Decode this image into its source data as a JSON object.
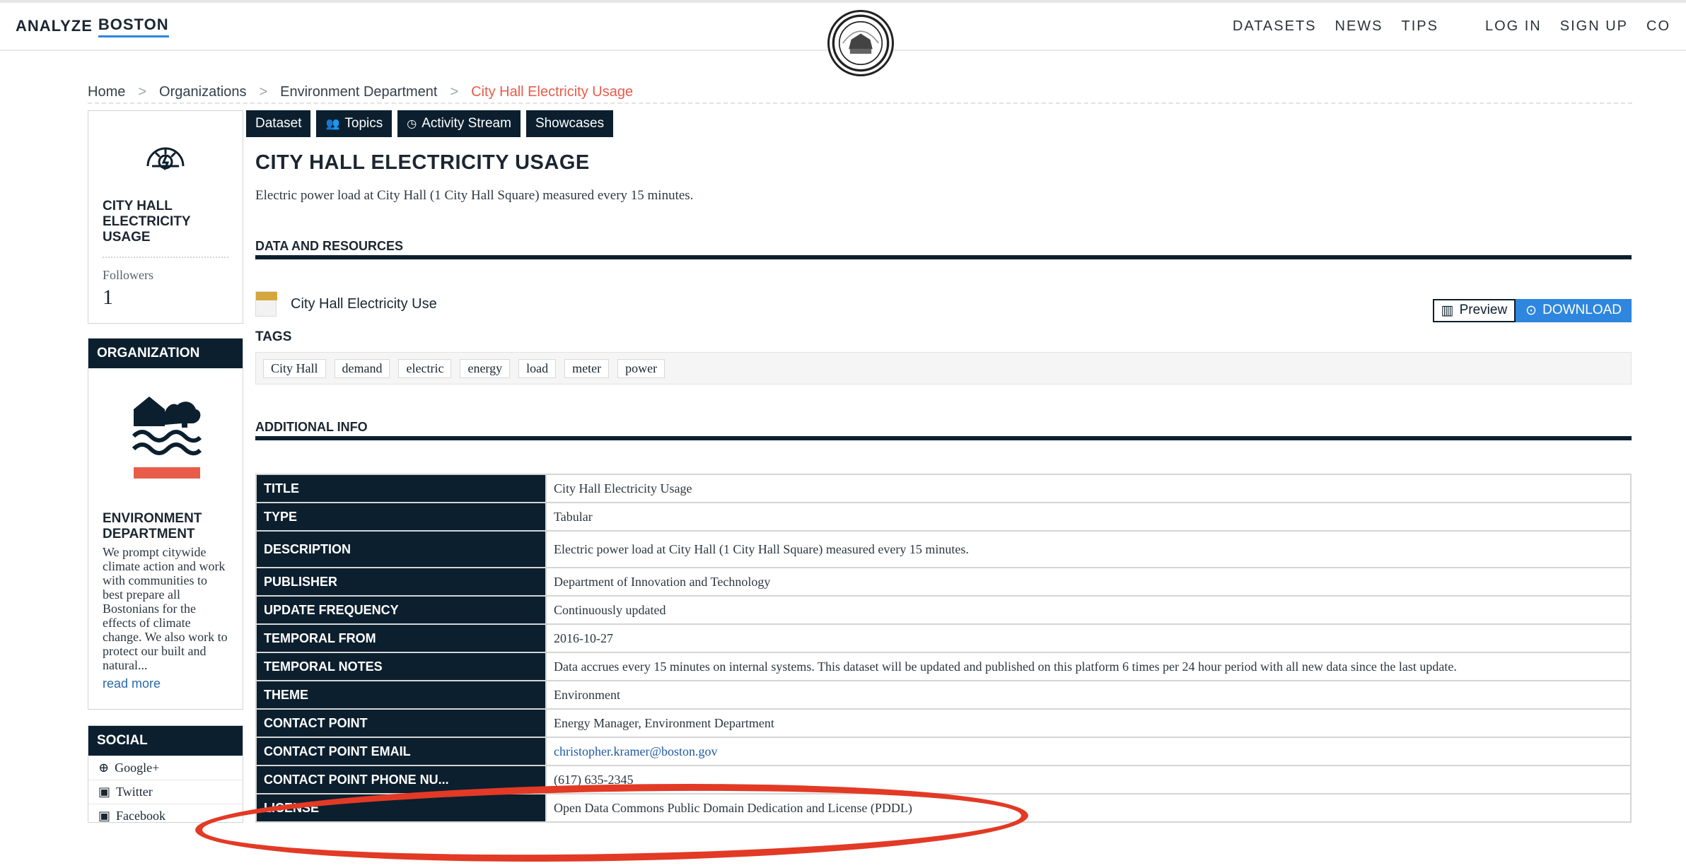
{
  "header": {
    "brand_part1": "ANALYZE",
    "brand_part2": "BOSTON",
    "nav": [
      "DATASETS",
      "NEWS",
      "TIPS",
      "LOG IN",
      "SIGN UP",
      "CO"
    ]
  },
  "breadcrumb": [
    "Home",
    "Organizations",
    "Environment Department",
    "City Hall Electricity Usage"
  ],
  "sidebar": {
    "dataset_title": "CITY HALL ELECTRICITY USAGE",
    "followers_label": "Followers",
    "followers_count": "1",
    "organization_header": "ORGANIZATION",
    "organization_name": "ENVIRONMENT DEPARTMENT",
    "organization_description": "We prompt citywide climate action and work with communities to best prepare all Bostonians for the effects of climate change. We also work to protect our built and natural...",
    "read_more": "read more",
    "social_header": "SOCIAL",
    "social": [
      {
        "icon": "google-plus-icon",
        "label": "Google+"
      },
      {
        "icon": "twitter-icon",
        "label": "Twitter"
      },
      {
        "icon": "facebook-icon",
        "label": "Facebook"
      }
    ]
  },
  "tabs": [
    {
      "label": "Dataset",
      "icon": ""
    },
    {
      "label": "Topics",
      "icon": "users-icon"
    },
    {
      "label": "Activity Stream",
      "icon": "clock-icon"
    },
    {
      "label": "Showcases",
      "icon": ""
    }
  ],
  "main": {
    "title": "CITY HALL ELECTRICITY USAGE",
    "description": "Electric power load at City Hall (1 City Hall Square) measured every 15 minutes.",
    "section_data": "DATA AND RESOURCES",
    "resource_name": "City Hall Electricity Use",
    "preview": "Preview",
    "download": "DOWNLOAD",
    "tags_label": "TAGS",
    "tags": [
      "City Hall",
      "demand",
      "electric",
      "energy",
      "load",
      "meter",
      "power"
    ],
    "section_info": "ADDITIONAL INFO",
    "info": [
      {
        "k": "TITLE",
        "v": "City Hall Electricity Usage"
      },
      {
        "k": "TYPE",
        "v": "Tabular"
      },
      {
        "k": "DESCRIPTION",
        "v": "Electric power load at City Hall (1 City Hall Square) measured every 15 minutes."
      },
      {
        "k": "PUBLISHER",
        "v": "Department of Innovation and Technology"
      },
      {
        "k": "UPDATE FREQUENCY",
        "v": "Continuously updated"
      },
      {
        "k": "TEMPORAL FROM",
        "v": "2016-10-27"
      },
      {
        "k": "TEMPORAL NOTES",
        "v": "Data accrues every 15 minutes on internal systems. This dataset will be updated and published on this platform 6 times per 24 hour period with all new data since the last update."
      },
      {
        "k": "THEME",
        "v": "Environment"
      },
      {
        "k": "CONTACT POINT",
        "v": "Energy Manager, Environment Department"
      },
      {
        "k": "CONTACT POINT EMAIL",
        "v": "christopher.kramer@boston.gov"
      },
      {
        "k": "CONTACT POINT PHONE NU...",
        "v": "(617) 635-2345"
      },
      {
        "k": "LICENSE",
        "v": "Open Data Commons Public Domain Dedication and License (PDDL)"
      }
    ]
  },
  "colors": {
    "navy": "#0c1f2e",
    "accent_blue": "#2e86de",
    "breadcrumb_active": "#e85c4a",
    "annotation_red": "#e23a25"
  }
}
